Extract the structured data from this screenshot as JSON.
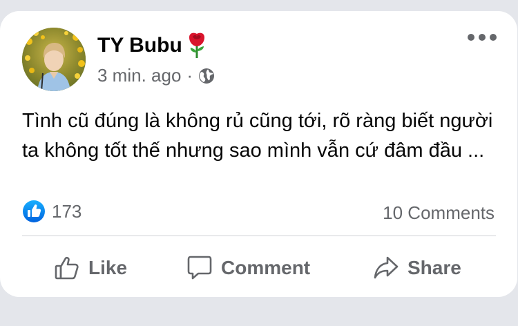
{
  "post": {
    "author": "TY Bubu",
    "author_emoji_icon": "rose-icon",
    "timestamp": "3 min. ago",
    "separator": "·",
    "audience_icon": "globe-icon",
    "text": "Tình cũ đúng là không rủ cũng tới, rõ ràng biết người ta không tốt thế nhưng sao mình vẫn cứ đâm đầu ...",
    "more_icon": "more-options-icon"
  },
  "stats": {
    "reaction_icon": "like-reaction-icon",
    "reaction_count": "173",
    "comments": "10 Comments"
  },
  "actions": {
    "like_label": "Like",
    "comment_label": "Comment",
    "share_label": "Share"
  },
  "colors": {
    "background": "#e4e6eb",
    "card": "#ffffff",
    "primary_text": "#050505",
    "secondary_text": "#65676b",
    "like_blue": "#1877f2",
    "divider": "#ced0d4"
  }
}
